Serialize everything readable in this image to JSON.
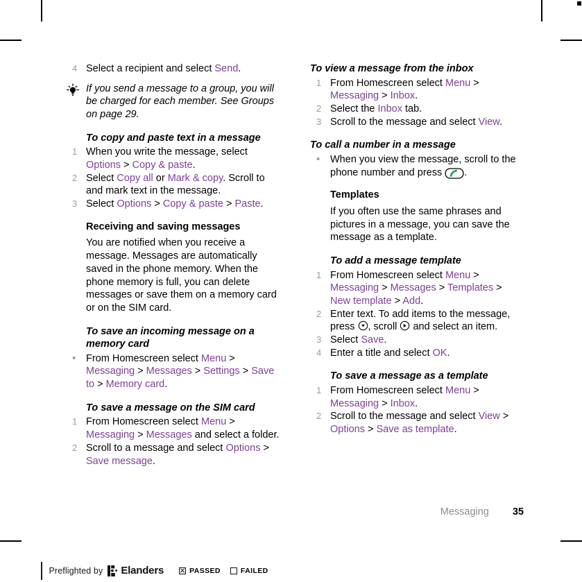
{
  "page": {
    "chapter": "Messaging",
    "number": "35",
    "accent_color": "#7e3f98",
    "marker_color": "#9a9a9a"
  },
  "left_column": {
    "step4": {
      "marker": "4",
      "parts": [
        {
          "t": "Select a recipient and select ",
          "s": "plain"
        },
        {
          "t": "Send",
          "s": "ui"
        },
        {
          "t": ".",
          "s": "plain"
        }
      ]
    },
    "tip": {
      "icon": "lightbulb-icon",
      "text": "If you send a message to a group, you will be charged for each member. See Groups on page 29."
    },
    "copy_paste": {
      "heading": "To copy and paste text in a message",
      "steps": [
        {
          "marker": "1",
          "parts": [
            {
              "t": "When you write the message, select ",
              "s": "plain"
            },
            {
              "t": "Options",
              "s": "ui"
            },
            {
              "t": " > ",
              "s": "plain"
            },
            {
              "t": "Copy & paste",
              "s": "ui"
            },
            {
              "t": ".",
              "s": "plain"
            }
          ]
        },
        {
          "marker": "2",
          "parts": [
            {
              "t": "Select ",
              "s": "plain"
            },
            {
              "t": "Copy all",
              "s": "ui"
            },
            {
              "t": " or ",
              "s": "plain"
            },
            {
              "t": "Mark & copy",
              "s": "ui"
            },
            {
              "t": ". Scroll to and mark text in the message.",
              "s": "plain"
            }
          ]
        },
        {
          "marker": "3",
          "parts": [
            {
              "t": "Select ",
              "s": "plain"
            },
            {
              "t": "Options",
              "s": "ui"
            },
            {
              "t": " > ",
              "s": "plain"
            },
            {
              "t": "Copy & paste",
              "s": "ui"
            },
            {
              "t": " > ",
              "s": "plain"
            },
            {
              "t": "Paste",
              "s": "ui"
            },
            {
              "t": ".",
              "s": "plain"
            }
          ]
        }
      ]
    },
    "receiving": {
      "heading": "Receiving and saving messages",
      "body": "You are notified when you receive a message. Messages are automatically saved in the phone memory. When the phone memory is full, you can delete messages or save them on a memory card or on the SIM card."
    },
    "save_memory_card": {
      "heading": "To save an incoming message on a memory card",
      "steps": [
        {
          "marker": "•",
          "parts": [
            {
              "t": "From Homescreen select ",
              "s": "plain"
            },
            {
              "t": "Menu",
              "s": "ui"
            },
            {
              "t": " > ",
              "s": "plain"
            },
            {
              "t": "Messaging",
              "s": "ui"
            },
            {
              "t": " > ",
              "s": "plain"
            },
            {
              "t": "Messages",
              "s": "ui"
            },
            {
              "t": " > ",
              "s": "plain"
            },
            {
              "t": "Settings",
              "s": "ui"
            },
            {
              "t": " > ",
              "s": "plain"
            },
            {
              "t": "Save to",
              "s": "ui"
            },
            {
              "t": " > ",
              "s": "plain"
            },
            {
              "t": "Memory card",
              "s": "ui"
            },
            {
              "t": ".",
              "s": "plain"
            }
          ]
        }
      ]
    },
    "save_sim_card": {
      "heading": "To save a message on the SIM card",
      "steps": [
        {
          "marker": "1",
          "parts": [
            {
              "t": "From Homescreen select ",
              "s": "plain"
            },
            {
              "t": "Menu",
              "s": "ui"
            },
            {
              "t": " > ",
              "s": "plain"
            },
            {
              "t": "Messaging",
              "s": "ui"
            },
            {
              "t": " > ",
              "s": "plain"
            },
            {
              "t": "Messages",
              "s": "ui"
            },
            {
              "t": " and select a folder.",
              "s": "plain"
            }
          ]
        },
        {
          "marker": "2",
          "parts": [
            {
              "t": "Scroll to a message and select ",
              "s": "plain"
            },
            {
              "t": "Options",
              "s": "ui"
            },
            {
              "t": " > ",
              "s": "plain"
            },
            {
              "t": "Save message",
              "s": "ui"
            },
            {
              "t": ".",
              "s": "plain"
            }
          ]
        }
      ]
    }
  },
  "right_column": {
    "view_inbox": {
      "heading": "To view a message from the inbox",
      "steps": [
        {
          "marker": "1",
          "parts": [
            {
              "t": "From Homescreen select ",
              "s": "plain"
            },
            {
              "t": "Menu",
              "s": "ui"
            },
            {
              "t": " > ",
              "s": "plain"
            },
            {
              "t": "Messaging",
              "s": "ui"
            },
            {
              "t": " > ",
              "s": "plain"
            },
            {
              "t": "Inbox",
              "s": "ui"
            },
            {
              "t": ".",
              "s": "plain"
            }
          ]
        },
        {
          "marker": "2",
          "parts": [
            {
              "t": "Select the ",
              "s": "plain"
            },
            {
              "t": "Inbox",
              "s": "ui"
            },
            {
              "t": " tab.",
              "s": "plain"
            }
          ]
        },
        {
          "marker": "3",
          "parts": [
            {
              "t": "Scroll to the message and select ",
              "s": "plain"
            },
            {
              "t": "View",
              "s": "ui"
            },
            {
              "t": ".",
              "s": "plain"
            }
          ]
        }
      ]
    },
    "call_number": {
      "heading": "To call a number in a message",
      "steps": [
        {
          "marker": "•",
          "parts": [
            {
              "t": "When you view the message, scroll to the phone number and press ",
              "s": "plain"
            },
            {
              "t": "",
              "s": "call-key-icon"
            },
            {
              "t": ".",
              "s": "plain"
            }
          ]
        }
      ]
    },
    "templates": {
      "heading": "Templates",
      "body": "If you often use the same phrases and pictures in a message, you can save the message as a template."
    },
    "add_template": {
      "heading": "To add a message template",
      "steps": [
        {
          "marker": "1",
          "parts": [
            {
              "t": "From Homescreen select ",
              "s": "plain"
            },
            {
              "t": "Menu",
              "s": "ui"
            },
            {
              "t": " > ",
              "s": "plain"
            },
            {
              "t": "Messaging",
              "s": "ui"
            },
            {
              "t": " > ",
              "s": "plain"
            },
            {
              "t": "Messages",
              "s": "ui"
            },
            {
              "t": " > ",
              "s": "plain"
            },
            {
              "t": "Templates",
              "s": "ui"
            },
            {
              "t": " > ",
              "s": "plain"
            },
            {
              "t": "New template",
              "s": "ui"
            },
            {
              "t": " > ",
              "s": "plain"
            },
            {
              "t": "Add",
              "s": "ui"
            },
            {
              "t": ".",
              "s": "plain"
            }
          ]
        },
        {
          "marker": "2",
          "parts": [
            {
              "t": "Enter text. To add items to the message, press ",
              "s": "plain"
            },
            {
              "t": "",
              "s": "nav-down-icon"
            },
            {
              "t": ", scroll ",
              "s": "plain"
            },
            {
              "t": "",
              "s": "nav-right-icon"
            },
            {
              "t": " and select an item.",
              "s": "plain"
            }
          ]
        },
        {
          "marker": "3",
          "parts": [
            {
              "t": "Select ",
              "s": "plain"
            },
            {
              "t": "Save",
              "s": "ui"
            },
            {
              "t": ".",
              "s": "plain"
            }
          ]
        },
        {
          "marker": "4",
          "parts": [
            {
              "t": "Enter a title and select ",
              "s": "plain"
            },
            {
              "t": "OK",
              "s": "ui"
            },
            {
              "t": ".",
              "s": "plain"
            }
          ]
        }
      ]
    },
    "save_as_template": {
      "heading": "To save a message as a template",
      "steps": [
        {
          "marker": "1",
          "parts": [
            {
              "t": "From Homescreen select ",
              "s": "plain"
            },
            {
              "t": "Menu",
              "s": "ui"
            },
            {
              "t": " > ",
              "s": "plain"
            },
            {
              "t": "Messaging",
              "s": "ui"
            },
            {
              "t": " > ",
              "s": "plain"
            },
            {
              "t": "Inbox",
              "s": "ui"
            },
            {
              "t": ".",
              "s": "plain"
            }
          ]
        },
        {
          "marker": "2",
          "parts": [
            {
              "t": "Scroll to the message and select ",
              "s": "plain"
            },
            {
              "t": "View",
              "s": "ui"
            },
            {
              "t": " > ",
              "s": "plain"
            },
            {
              "t": "Options",
              "s": "ui"
            },
            {
              "t": " > ",
              "s": "plain"
            },
            {
              "t": "Save as template",
              "s": "ui"
            },
            {
              "t": ".",
              "s": "plain"
            }
          ]
        }
      ]
    }
  },
  "preflight": {
    "label": "Preflighted by",
    "brand": "Elanders",
    "logo": "elanders-logo-icon",
    "passed_label": "PASSED",
    "failed_label": "FAILED",
    "passed_checked": true,
    "failed_checked": false
  }
}
